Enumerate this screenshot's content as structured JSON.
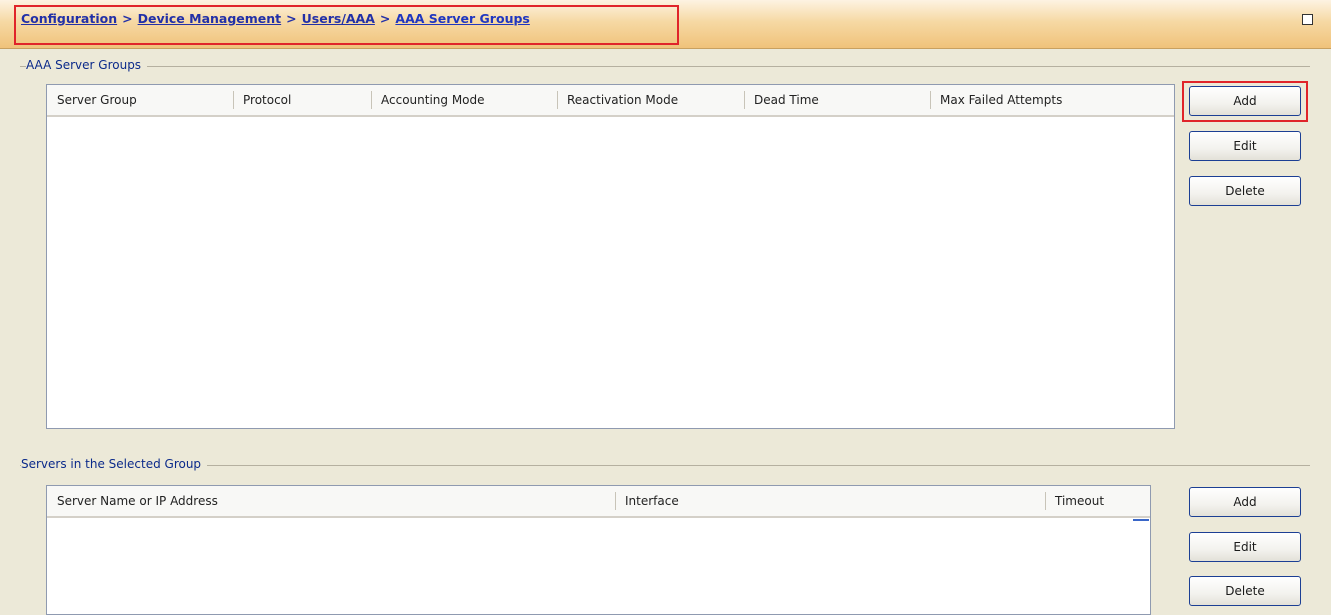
{
  "breadcrumb": {
    "items": [
      "Configuration",
      "Device Management",
      "Users/AAA",
      "AAA Server Groups"
    ],
    "separator": ">"
  },
  "server_groups": {
    "label": "AAA Server Groups",
    "columns": [
      "Server Group",
      "Protocol",
      "Accounting Mode",
      "Reactivation Mode",
      "Dead Time",
      "Max Failed Attempts"
    ],
    "rows": [],
    "buttons": {
      "add": "Add",
      "edit": "Edit",
      "delete": "Delete"
    }
  },
  "servers": {
    "label": "Servers in the Selected Group",
    "columns": [
      "Server Name or IP Address",
      "Interface",
      "Timeout"
    ],
    "rows": [],
    "buttons": {
      "add": "Add",
      "edit": "Edit",
      "delete": "Delete"
    }
  },
  "colors": {
    "highlight": "#e0242a",
    "link": "#2230a8",
    "group_label": "#0b2a8a",
    "button_border": "#1c3f94"
  }
}
